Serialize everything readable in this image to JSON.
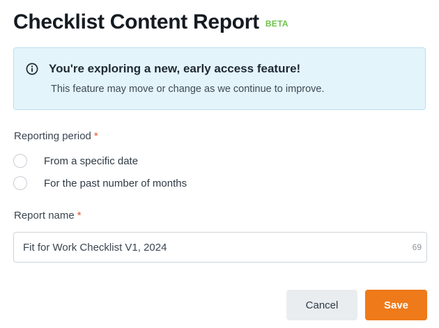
{
  "header": {
    "title": "Checklist Content Report",
    "badge": "BETA"
  },
  "banner": {
    "icon": "info-circle-icon",
    "title": "You're exploring a new, early access feature!",
    "text": "This feature may move or change as we continue to improve."
  },
  "reporting_period": {
    "label": "Reporting period",
    "required_mark": "*",
    "options": [
      {
        "label": "From a specific date",
        "selected": false
      },
      {
        "label": "For the past number of months",
        "selected": false
      }
    ]
  },
  "report_name": {
    "label": "Report name",
    "required_mark": "*",
    "value": "Fit for Work Checklist V1, 2024",
    "char_count": "69"
  },
  "actions": {
    "cancel_label": "Cancel",
    "save_label": "Save"
  },
  "colors": {
    "accent": "#ee7a1a",
    "beta": "#6cc24a",
    "required": "#e8502e",
    "banner_bg": "#e4f4fb"
  }
}
